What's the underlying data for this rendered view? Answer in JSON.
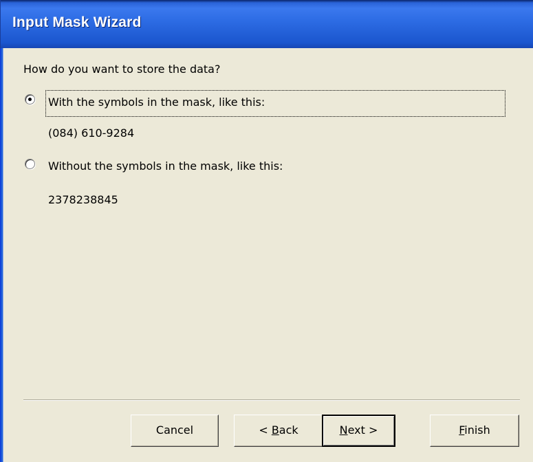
{
  "window": {
    "title": "Input Mask Wizard"
  },
  "question": "How do you want to store the data?",
  "options": [
    {
      "label": "With the symbols in the mask, like this:",
      "example": "(084) 610-9284",
      "selected": true
    },
    {
      "label": "Without the symbols in the mask, like this:",
      "example": "2378238845",
      "selected": false
    }
  ],
  "buttons": {
    "cancel": {
      "label": "Cancel"
    },
    "back": {
      "prefix": "< ",
      "mnemonic": "B",
      "rest": "ack"
    },
    "next": {
      "mnemonic": "N",
      "rest": "ext >"
    },
    "finish": {
      "mnemonic": "F",
      "rest": "inish"
    }
  },
  "colors": {
    "titlebar": "#2d6ce4",
    "dialog_background": "#ece9d8",
    "title_text": "#ffffff"
  }
}
